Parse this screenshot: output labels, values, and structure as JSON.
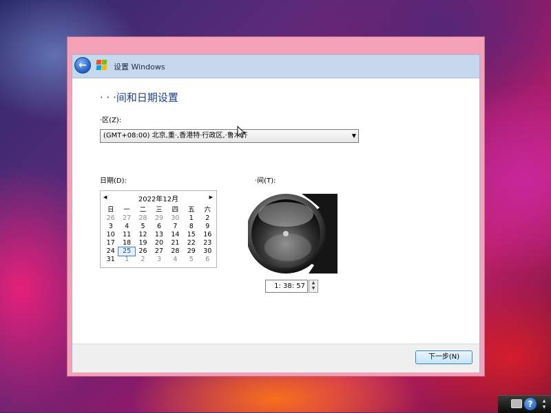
{
  "window": {
    "title": "设置 Windows",
    "heading": "· · ·间和日期设置"
  },
  "timezone": {
    "label": "·区(Z):",
    "value": "(GMT+08:00) 北京,重·,香港特·行政区,·鲁木齐"
  },
  "date": {
    "label": "日期(D):",
    "month_title": "2022年12月",
    "weekdays": [
      "日",
      "一",
      "二",
      "三",
      "四",
      "五",
      "六"
    ],
    "weeks": [
      [
        "26",
        "27",
        "28",
        "29",
        "30",
        "1",
        "2"
      ],
      [
        "3",
        "4",
        "5",
        "6",
        "7",
        "8",
        "9"
      ],
      [
        "10",
        "11",
        "12",
        "13",
        "14",
        "15",
        "16"
      ],
      [
        "17",
        "18",
        "19",
        "20",
        "21",
        "22",
        "23"
      ],
      [
        "24",
        "25",
        "26",
        "27",
        "28",
        "29",
        "30"
      ],
      [
        "31",
        "1",
        "2",
        "3",
        "4",
        "5",
        "6"
      ]
    ],
    "selected_day": "25"
  },
  "time": {
    "label": "·间(T):",
    "value": "1: 38: 57"
  },
  "footer": {
    "next_label": "下一步(N)"
  },
  "icons": {
    "back": "back-arrow-icon",
    "logo": "windows-logo-icon",
    "prev": "triangle-left-icon",
    "next": "triangle-right-icon",
    "keyboard": "keyboard-icon",
    "help": "help-icon"
  }
}
